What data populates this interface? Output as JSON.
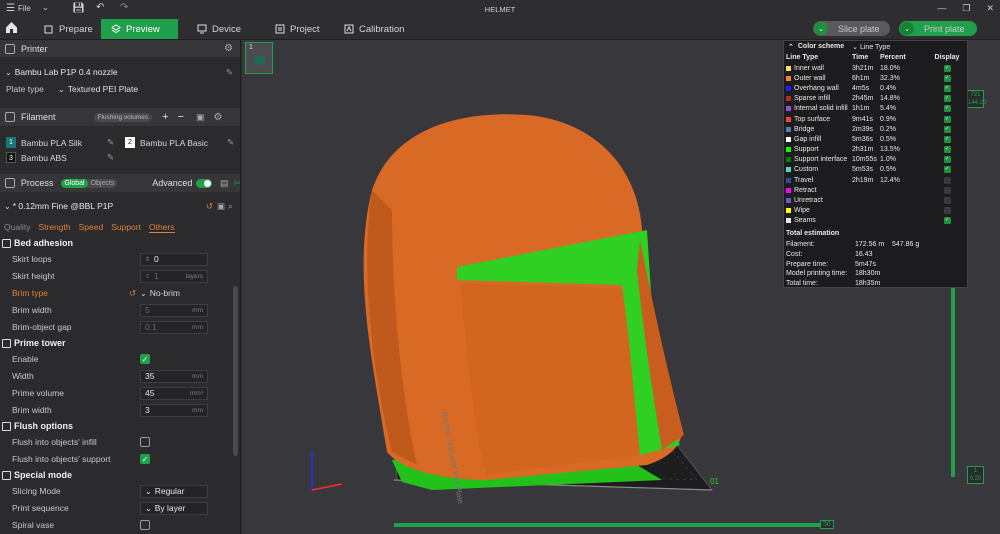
{
  "titlebar": {
    "file": "File",
    "title": "HELMET"
  },
  "toolbar": {
    "tabs": [
      "Prepare",
      "Preview",
      "Device",
      "Project",
      "Calibration"
    ],
    "slice_label": "Slice plate",
    "print_label": "Print plate"
  },
  "left": {
    "printer_header": "Printer",
    "printer_name": "Bambu Lab P1P 0.4 nozzle",
    "plate_type_label": "Plate type",
    "plate_type_value": "Textured PEI Plate",
    "filament_header": "Filament",
    "flushing_label": "Flushing volumes",
    "filaments": [
      {
        "num": "1",
        "name": "Bambu PLA Silk",
        "color": "#17787a"
      },
      {
        "num": "2",
        "name": "Bambu PLA Basic",
        "color": "#ffffff"
      },
      {
        "num": "3",
        "name": "Bambu ABS",
        "color": "#111111"
      }
    ],
    "process_header": "Process",
    "global_label": "Global",
    "objects_label": "Objects",
    "advanced_label": "Advanced",
    "profile": "* 0.12mm Fine @BBL P1P",
    "setting_tabs": [
      "Quality",
      "Strength",
      "Speed",
      "Support",
      "Others"
    ],
    "bed_adhesion": {
      "title": "Bed adhesion",
      "skirt_loops_label": "Skirt loops",
      "skirt_loops_value": "0",
      "skirt_height_label": "Skirt height",
      "skirt_height_value": "1",
      "skirt_height_unit": "layers",
      "brim_type_label": "Brim type",
      "brim_type_value": "No-brim",
      "brim_width_label": "Brim width",
      "brim_width_value": "5",
      "brim_width_unit": "mm",
      "brim_gap_label": "Brim-object gap",
      "brim_gap_value": "0.1",
      "brim_gap_unit": "mm"
    },
    "prime_tower": {
      "title": "Prime tower",
      "enable_label": "Enable",
      "width_label": "Width",
      "width_value": "35",
      "width_unit": "mm",
      "volume_label": "Prime volume",
      "volume_value": "45",
      "volume_unit": "mm³",
      "brim_label": "Brim width",
      "brim_value": "3",
      "brim_unit": "mm"
    },
    "flush_options": {
      "title": "Flush options",
      "infill_label": "Flush into objects' infill",
      "support_label": "Flush into objects' support"
    },
    "special_mode": {
      "title": "Special mode",
      "slicing_mode_label": "Slicing Mode",
      "slicing_mode_value": "Regular",
      "print_seq_label": "Print sequence",
      "print_seq_value": "By layer",
      "spiral_label": "Spiral vase"
    }
  },
  "legend": {
    "color_scheme": "Color scheme",
    "scheme_value": "Line Type",
    "headers": [
      "Line Type",
      "Time",
      "Percent",
      "Display"
    ],
    "rows": [
      {
        "name": "Inner wall",
        "time": "3h21m",
        "pct": "18.0%",
        "color": "#ffe64d",
        "on": true
      },
      {
        "name": "Outer wall",
        "time": "6h1m",
        "pct": "32.3%",
        "color": "#ff7d38",
        "on": true
      },
      {
        "name": "Overhang wall",
        "time": "4m5s",
        "pct": "0.4%",
        "color": "#1f1fff",
        "on": true
      },
      {
        "name": "Sparse infill",
        "time": "2h45m",
        "pct": "14.8%",
        "color": "#b03029",
        "on": true
      },
      {
        "name": "Internal solid infill",
        "time": "1h1m",
        "pct": "5.4%",
        "color": "#9654cc",
        "on": true
      },
      {
        "name": "Top surface",
        "time": "9m41s",
        "pct": "0.9%",
        "color": "#f04040",
        "on": true
      },
      {
        "name": "Bridge",
        "time": "2m39s",
        "pct": "0.2%",
        "color": "#4d80ba",
        "on": true
      },
      {
        "name": "Gap infill",
        "time": "5m36s",
        "pct": "0.5%",
        "color": "#ffffff",
        "on": true
      },
      {
        "name": "Support",
        "time": "2h31m",
        "pct": "13.5%",
        "color": "#00ff00",
        "on": true
      },
      {
        "name": "Support interface",
        "time": "10m55s",
        "pct": "1.0%",
        "color": "#008000",
        "on": true
      },
      {
        "name": "Custom",
        "time": "5m53s",
        "pct": "0.5%",
        "color": "#5ed1b6",
        "on": true
      },
      {
        "name": "Travel",
        "time": "2h19m",
        "pct": "12.4%",
        "color": "#38489a",
        "on": false
      },
      {
        "name": "Retract",
        "time": "",
        "pct": "",
        "color": "#ff00ff",
        "on": false
      },
      {
        "name": "Unretract",
        "time": "",
        "pct": "",
        "color": "#6a5acd",
        "on": false
      },
      {
        "name": "Wipe",
        "time": "",
        "pct": "",
        "color": "#ffff00",
        "on": false
      },
      {
        "name": "Seams",
        "time": "",
        "pct": "",
        "color": "#e6e6e6",
        "on": true
      }
    ],
    "estimation_title": "Total estimation",
    "estimation": [
      {
        "k": "Filament:",
        "v": "172.56 m    547.86 g"
      },
      {
        "k": "Cost:",
        "v": "16.43"
      },
      {
        "k": "Prepare time:",
        "v": "5m47s"
      },
      {
        "k": "Model printing time:",
        "v": "18h30m"
      },
      {
        "k": "Total time:",
        "v": "18h35m"
      }
    ]
  },
  "viewport": {
    "plate_number": "1",
    "layer_top": "721",
    "layer_top_height": "144.20",
    "layer_bottom": "1",
    "layer_bottom_height": "0.20",
    "move_value": "56",
    "plate_label": "01"
  }
}
